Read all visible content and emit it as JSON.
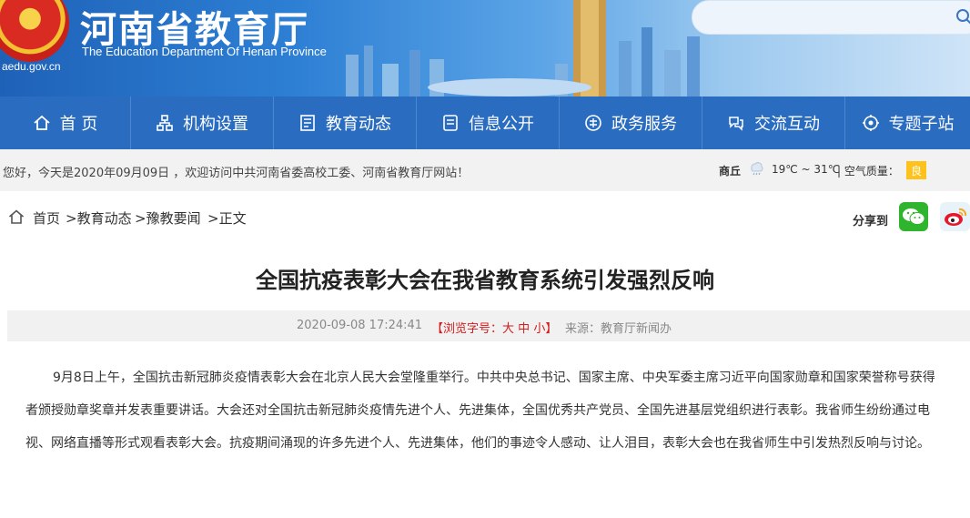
{
  "header": {
    "site_title": "河南省教育厅",
    "site_subtitle": "The Education Department Of Henan Province",
    "domain_fragment": "aedu.gov.cn",
    "search_placeholder": ""
  },
  "nav": [
    {
      "label": "首 页",
      "icon": "home-icon"
    },
    {
      "label": "机构设置",
      "icon": "org-chart-icon"
    },
    {
      "label": "教育动态",
      "icon": "news-icon"
    },
    {
      "label": "信息公开",
      "icon": "document-icon"
    },
    {
      "label": "政务服务",
      "icon": "government-icon"
    },
    {
      "label": "交流互动",
      "icon": "interaction-icon"
    },
    {
      "label": "专题子站",
      "icon": "topic-icon"
    }
  ],
  "welcome": {
    "text": "您好，今天是2020年09月09日 ，欢迎访问中共河南省委高校工委、河南省教育厅网站！",
    "city": "商丘",
    "weather_icon": "cloud-rain-icon",
    "temperature": "19℃ ~ 31℃",
    "air_quality_label": "| 空气质量：",
    "air_quality_value": "良"
  },
  "breadcrumb": {
    "home": "首页",
    "items": [
      ">教育动态",
      ">豫教要闻",
      ">正文"
    ]
  },
  "share": {
    "label": "分享到",
    "wechat_icon": "wechat-icon",
    "weibo_icon": "weibo-icon"
  },
  "article": {
    "title": "全国抗疫表彰大会在我省教育系统引发强烈反响",
    "datetime": "2020-09-08 17:24:41",
    "font_size_label": "【浏览字号：",
    "font_size_large": "大",
    "font_size_medium": "中",
    "font_size_small": "小】",
    "source": "来源：教育厅新闻办",
    "body": "9月8日上午，全国抗击新冠肺炎疫情表彰大会在北京人民大会堂隆重举行。中共中央总书记、国家主席、中央军委主席习近平向国家勋章和国家荣誉称号获得者颁授勋章奖章并发表重要讲话。大会还对全国抗击新冠肺炎疫情先进个人、先进集体，全国优秀共产党员、全国先进基层党组织进行表彰。我省师生纷纷通过电视、网络直播等形式观看表彰大会。抗疫期间涌现的许多先进个人、先进集体，他们的事迹令人感动、让人泪目，表彰大会也在我省师生中引发热烈反响与讨论。"
  },
  "colors": {
    "nav_bg": "#2a6cc0",
    "accent_red": "#d41c1c",
    "aq_badge": "#ffc21a",
    "wechat_green": "#2fb52d"
  }
}
